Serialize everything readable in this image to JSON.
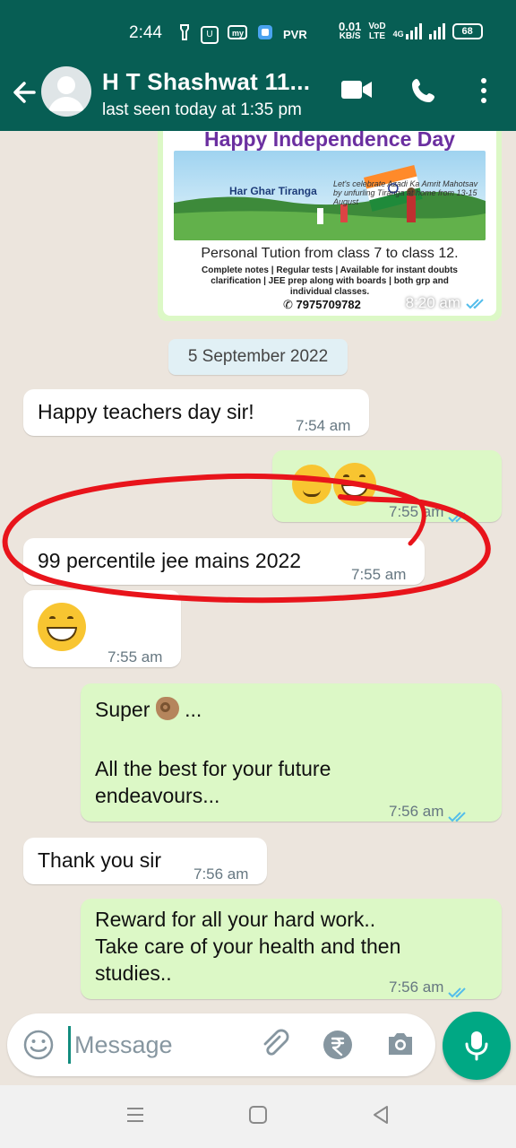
{
  "status_bar": {
    "time": "2:44",
    "carrier_label": "PVR",
    "net_speed_value": "0.01",
    "net_speed_unit": "KB/S",
    "volte_top": "VoD",
    "volte_bottom": "LTE",
    "network": "4G",
    "battery": "68"
  },
  "header": {
    "contact_name": "H T Shashwat 11...",
    "last_seen": "last seen today at 1:35 pm"
  },
  "poster": {
    "title": "Happy Independence Day",
    "campaign": "Har Ghar Tiranga",
    "campaign_sub": "Let's celebrate Azadi Ka Amrit Mahotsav by unfurling Tiranga at home from 13-15 August",
    "line1": "Personal Tution from class 7 to class 12.",
    "line2": "Complete notes | Regular tests | Available for instant doubts clarification | JEE prep along with boards | both grp and individual classes.",
    "phone": "7975709782",
    "time": "8:20 am"
  },
  "date_chip": "5 September 2022",
  "messages": [
    {
      "dir": "in",
      "text": "Happy teachers day sir!",
      "time": "7:54 am"
    },
    {
      "dir": "out",
      "text": "",
      "emoji": [
        "slightly-smiling-face",
        "grinning-face"
      ],
      "time": "7:55 am"
    },
    {
      "dir": "in",
      "text": "99 percentile jee mains 2022",
      "time": "7:55 am"
    },
    {
      "dir": "in",
      "text": "",
      "emoji": [
        "grinning-face"
      ],
      "time": "7:55 am"
    },
    {
      "dir": "out",
      "text_line1": "Super",
      "text_line1_suffix": " ...",
      "text_line2": "All the best for your future",
      "text_line3": "endeavours...",
      "time": "7:56 am"
    },
    {
      "dir": "in",
      "text": "Thank you sir",
      "time": "7:56 am"
    },
    {
      "dir": "out",
      "text_line1": "Reward for all your hard work..",
      "text_line2": "Take care of your health and then",
      "text_line3": "studies..",
      "time": "7:56 am"
    }
  ],
  "composer": {
    "placeholder": "Message"
  },
  "colors": {
    "header": "#075e54",
    "outgoing_bubble": "#dcf8c6",
    "incoming_bubble": "#ffffff",
    "read_tick": "#53bdeb",
    "annotation_red": "#e8141b",
    "mic_button": "#00a884"
  },
  "icons": [
    "back-arrow-icon",
    "video-call-icon",
    "voice-call-icon",
    "more-options-icon",
    "emoji-icon",
    "attach-icon",
    "rupee-payment-icon",
    "camera-icon",
    "mic-icon",
    "recents-nav-icon",
    "home-nav-icon",
    "back-nav-icon"
  ]
}
